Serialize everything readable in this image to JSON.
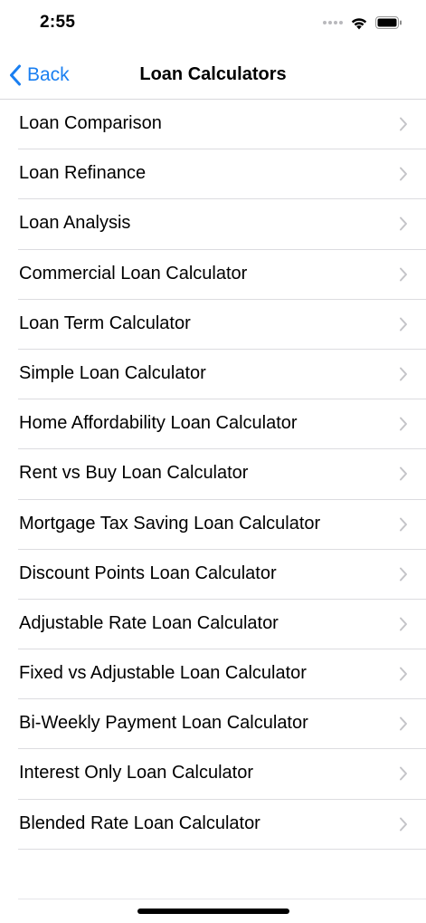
{
  "status_bar": {
    "time": "2:55"
  },
  "nav": {
    "back_label": "Back",
    "title": "Loan Calculators"
  },
  "list": {
    "items": [
      {
        "label": "Loan Comparison"
      },
      {
        "label": "Loan Refinance"
      },
      {
        "label": "Loan Analysis"
      },
      {
        "label": "Commercial Loan Calculator"
      },
      {
        "label": "Loan Term Calculator"
      },
      {
        "label": "Simple Loan Calculator"
      },
      {
        "label": "Home Affordability Loan Calculator"
      },
      {
        "label": "Rent vs Buy Loan Calculator"
      },
      {
        "label": "Mortgage Tax Saving Loan Calculator"
      },
      {
        "label": "Discount Points Loan Calculator"
      },
      {
        "label": "Adjustable Rate Loan Calculator"
      },
      {
        "label": "Fixed vs Adjustable Loan Calculator"
      },
      {
        "label": "Bi-Weekly Payment Loan Calculator"
      },
      {
        "label": "Interest Only Loan Calculator"
      },
      {
        "label": "Blended Rate Loan Calculator"
      }
    ]
  },
  "colors": {
    "accent": "#1a7ff1",
    "chevron": "#c4c4c8",
    "separator": "#dcdce0"
  },
  "icons": {
    "back": "chevron-left-icon",
    "row": "chevron-right-icon",
    "wifi": "wifi-icon",
    "battery": "battery-icon",
    "signal": "cellular-signal-icon"
  }
}
